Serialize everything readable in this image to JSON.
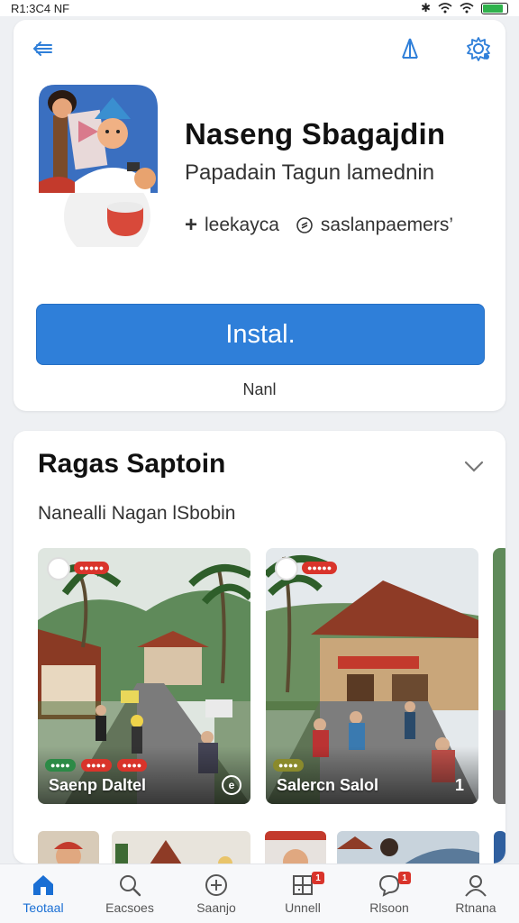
{
  "status_bar": {
    "time": "R1:3C4 NF",
    "battery_level": 0.85
  },
  "app": {
    "name": "Naseng Sbagajdin",
    "subtitle": "Papadain Tagun lamednin",
    "meta_left": "leekayca",
    "meta_right": "saslanpaemers’",
    "install_label": "Instal.",
    "secondary_label": "Nanl"
  },
  "section": {
    "title": "Ragas Saptoin",
    "subtitle": "Nanealli Nagan lSbobin",
    "tiles": [
      {
        "caption": "Saenp Daltel",
        "corner": "e"
      },
      {
        "caption": "Salercn Salol",
        "corner": "1"
      }
    ]
  },
  "bottom_nav": [
    {
      "label": "Teotaal",
      "icon": "home-icon",
      "active": true
    },
    {
      "label": "Eacsoes",
      "icon": "search-icon",
      "active": false
    },
    {
      "label": "Saanjo",
      "icon": "add-circle-icon",
      "active": false
    },
    {
      "label": "Unnell",
      "icon": "grid-icon",
      "active": false,
      "badge": "1"
    },
    {
      "label": "Rlsoon",
      "icon": "chat-icon",
      "active": false,
      "badge": "1"
    },
    {
      "label": "Rtnana",
      "icon": "profile-icon",
      "active": false
    }
  ],
  "colors": {
    "accent": "#2f7fd9",
    "badge": "#d9342b",
    "active_nav": "#1a6fd4"
  }
}
